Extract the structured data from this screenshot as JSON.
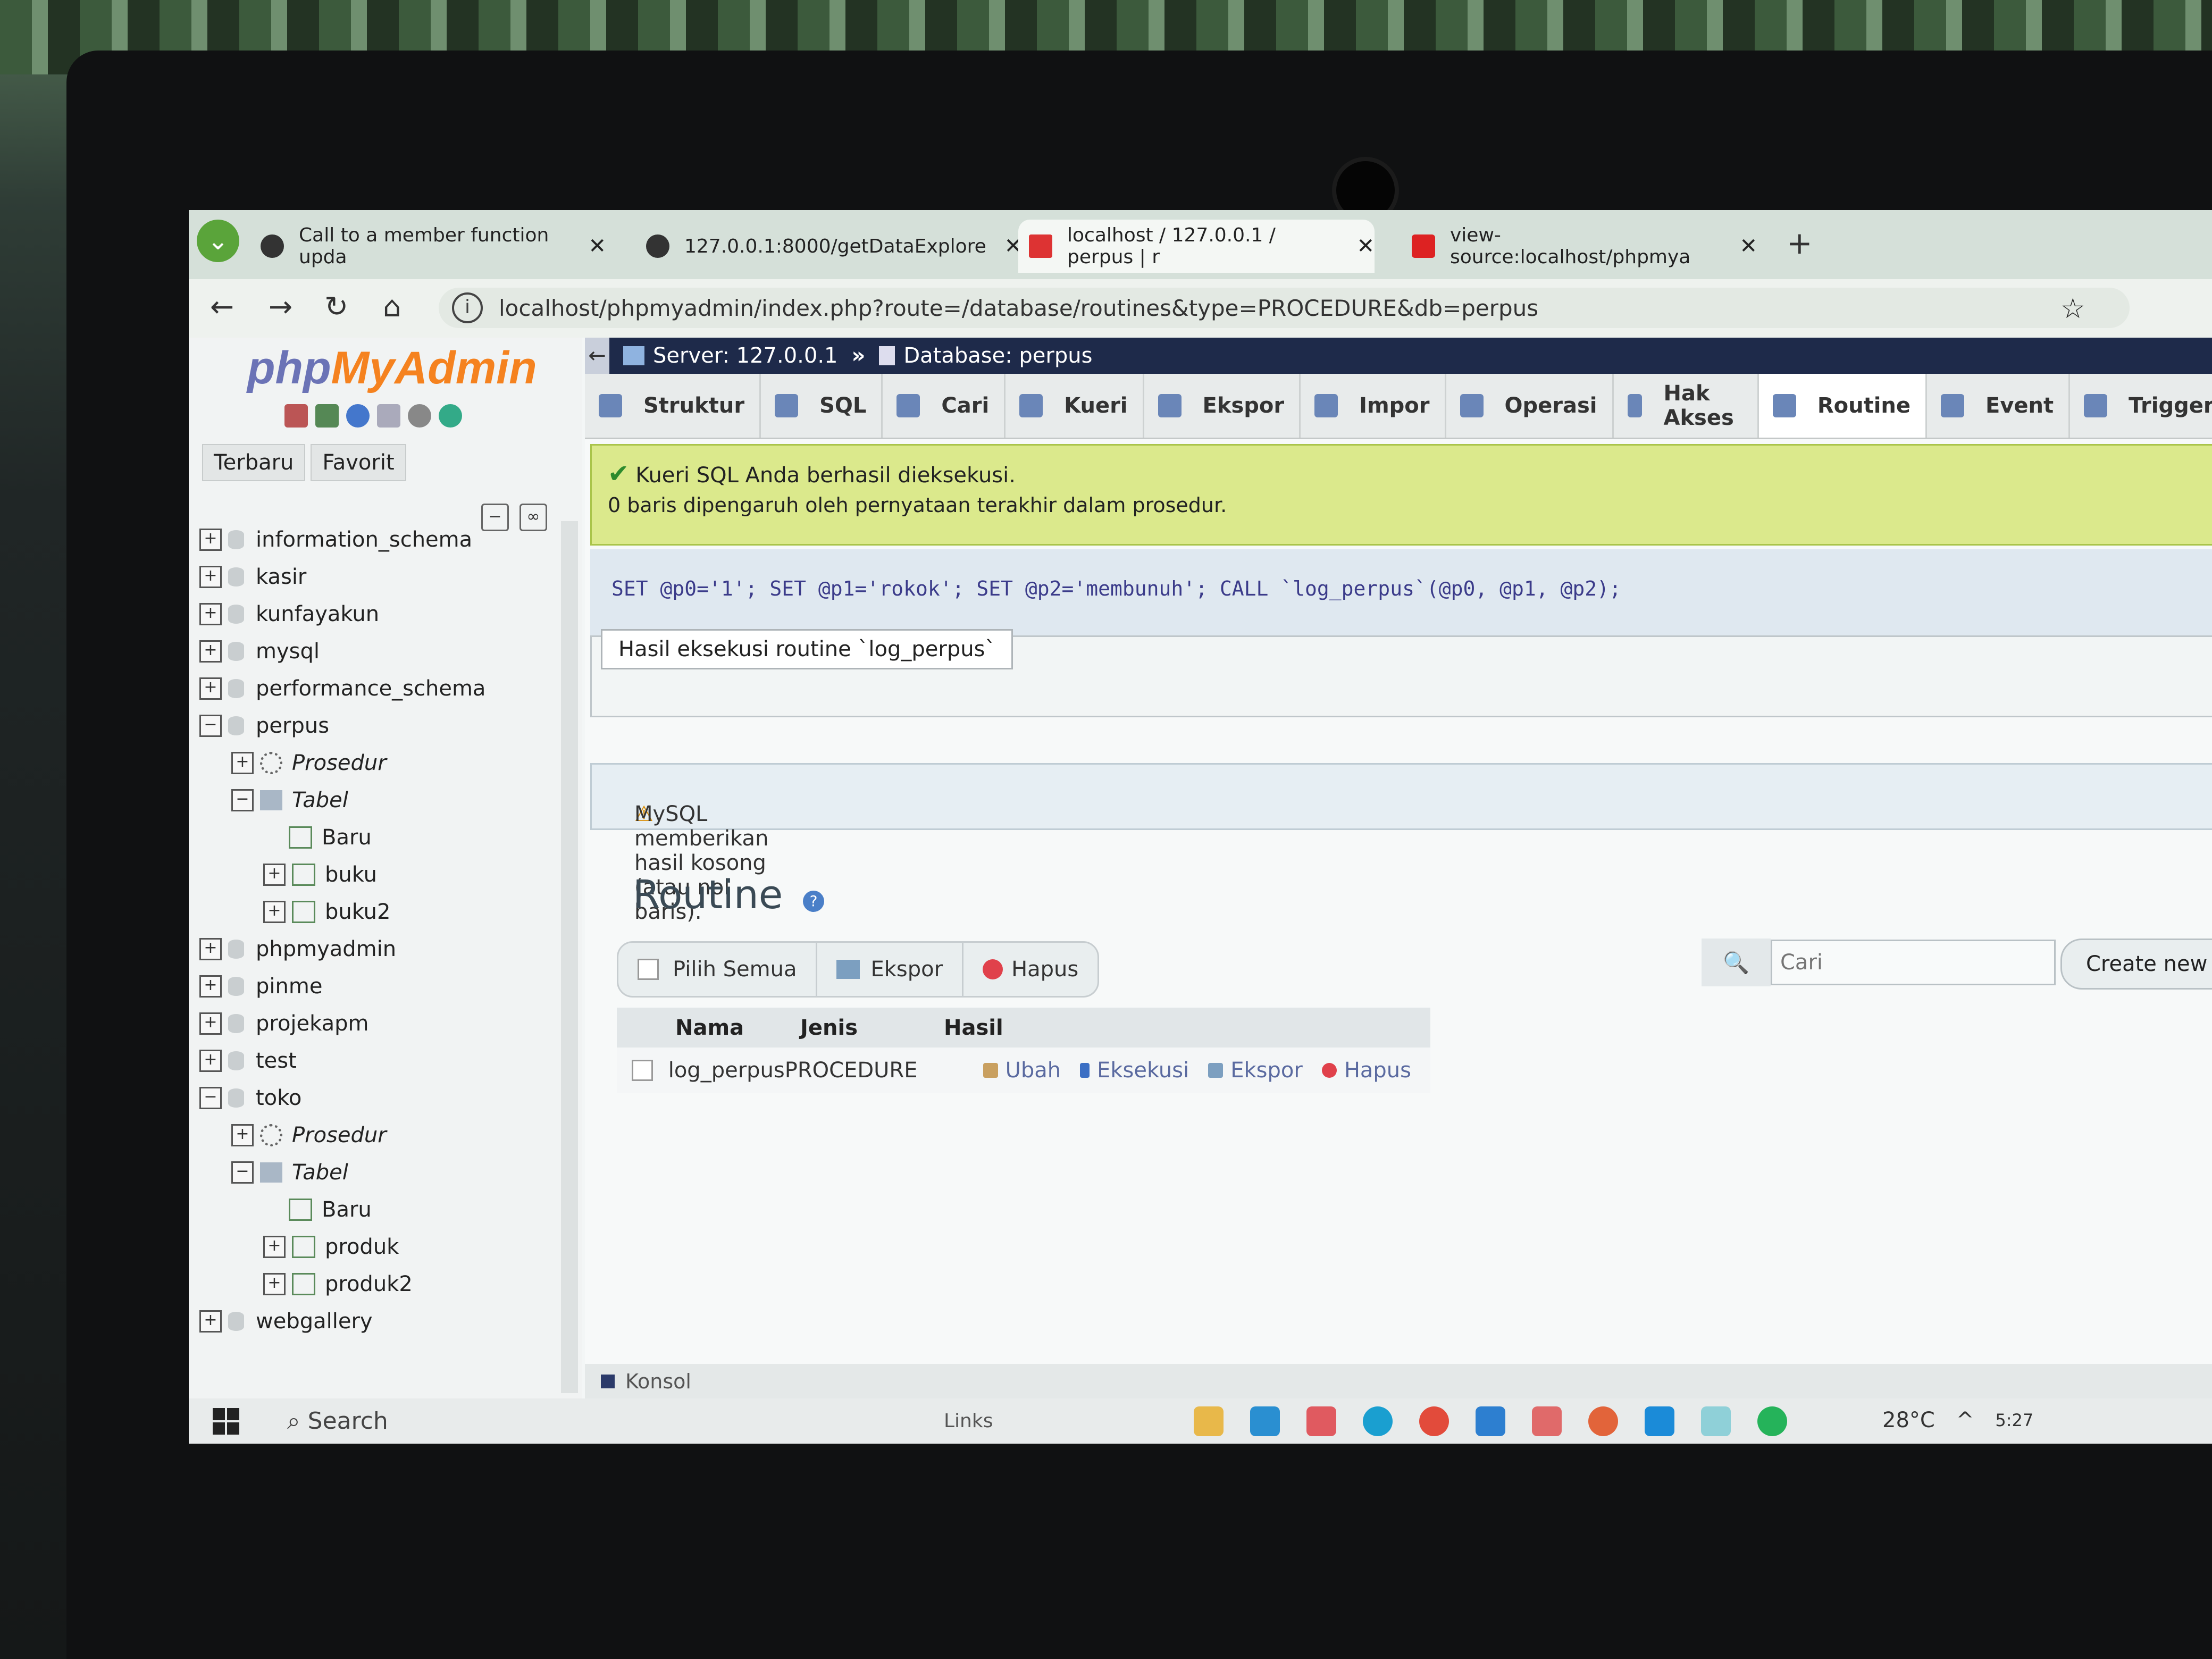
{
  "browser": {
    "tabs": [
      {
        "label": "Call to a member function upda",
        "active": false
      },
      {
        "label": "127.0.0.1:8000/getDataExplore",
        "active": false
      },
      {
        "label": "localhost / 127.0.0.1 / perpus | r",
        "active": true
      },
      {
        "label": "view-source:localhost/phpmya",
        "active": false
      }
    ],
    "new_tab": "+",
    "url": "localhost/phpmyadmin/index.php?route=/database/routines&type=PROCEDURE&db=perpus"
  },
  "nav": {
    "logo_php": "php",
    "logo_myadmin": "MyAdmin",
    "recent_tabs": [
      "Terbaru",
      "Favorit"
    ],
    "tree": [
      {
        "label": "information_schema",
        "level": 0,
        "kind": "db",
        "exp": "+"
      },
      {
        "label": "kasir",
        "level": 0,
        "kind": "db",
        "exp": "+"
      },
      {
        "label": "kunfayakun",
        "level": 0,
        "kind": "db",
        "exp": "+"
      },
      {
        "label": "mysql",
        "level": 0,
        "kind": "db",
        "exp": "+"
      },
      {
        "label": "performance_schema",
        "level": 0,
        "kind": "db",
        "exp": "+"
      },
      {
        "label": "perpus",
        "level": 0,
        "kind": "db",
        "exp": "−"
      },
      {
        "label": "Prosedur",
        "level": 1,
        "kind": "proc",
        "exp": "+",
        "italic": true
      },
      {
        "label": "Tabel",
        "level": 1,
        "kind": "folder",
        "exp": "−",
        "italic": true
      },
      {
        "label": "Baru",
        "level": 2,
        "kind": "new",
        "exp": ""
      },
      {
        "label": "buku",
        "level": 2,
        "kind": "table",
        "exp": "+"
      },
      {
        "label": "buku2",
        "level": 2,
        "kind": "table",
        "exp": "+"
      },
      {
        "label": "phpmyadmin",
        "level": 0,
        "kind": "db",
        "exp": "+"
      },
      {
        "label": "pinme",
        "level": 0,
        "kind": "db",
        "exp": "+"
      },
      {
        "label": "projekapm",
        "level": 0,
        "kind": "db",
        "exp": "+"
      },
      {
        "label": "test",
        "level": 0,
        "kind": "db",
        "exp": "+"
      },
      {
        "label": "toko",
        "level": 0,
        "kind": "db",
        "exp": "−"
      },
      {
        "label": "Prosedur",
        "level": 1,
        "kind": "proc",
        "exp": "+",
        "italic": true
      },
      {
        "label": "Tabel",
        "level": 1,
        "kind": "folder",
        "exp": "−",
        "italic": true
      },
      {
        "label": "Baru",
        "level": 2,
        "kind": "new",
        "exp": ""
      },
      {
        "label": "produk",
        "level": 2,
        "kind": "table",
        "exp": "+"
      },
      {
        "label": "produk2",
        "level": 2,
        "kind": "table",
        "exp": "+"
      },
      {
        "label": "webgallery",
        "level": 0,
        "kind": "db",
        "exp": "+"
      }
    ]
  },
  "breadcrumb": {
    "server": "Server: 127.0.0.1",
    "sep": "»",
    "database": "Database: perpus"
  },
  "menu": [
    {
      "label": "Struktur",
      "active": false
    },
    {
      "label": "SQL",
      "active": false
    },
    {
      "label": "Cari",
      "active": false
    },
    {
      "label": "Kueri",
      "active": false
    },
    {
      "label": "Ekspor",
      "active": false
    },
    {
      "label": "Impor",
      "active": false
    },
    {
      "label": "Operasi",
      "active": false
    },
    {
      "label": "Hak Akses",
      "active": false
    },
    {
      "label": "Routine",
      "active": true
    },
    {
      "label": "Event",
      "active": false
    },
    {
      "label": "Trigger",
      "active": false
    }
  ],
  "success": {
    "line1": "Kueri SQL Anda berhasil dieksekusi.",
    "line2": "0 baris dipengaruh oleh pernyataan terakhir dalam prosedur."
  },
  "sql": "SET @p0='1'; SET @p1='rokok'; SET @p2='membunuh'; CALL `log_perpus`(@p0, @p1, @p2);",
  "result_legend": "Hasil eksekusi routine `log_perpus`",
  "notice": "MySQL memberikan hasil kosong (atau nol baris).",
  "routine": {
    "title": "Routine",
    "actions": {
      "select_all": "Pilih Semua",
      "export": "Ekspor",
      "delete": "Hapus"
    },
    "search_placeholder": "Cari",
    "create_label": "Create new",
    "columns": [
      "Nama",
      "Jenis",
      "Hasil"
    ],
    "rows": [
      {
        "name": "log_perpus",
        "type": "PROCEDURE",
        "result": "",
        "actions": [
          "Ubah",
          "Eksekusi",
          "Ekspor",
          "Hapus"
        ]
      }
    ]
  },
  "console_label": "Konsol",
  "taskbar": {
    "search": "Search",
    "links": "Links",
    "temperature": "28°C",
    "time": "5:27"
  }
}
